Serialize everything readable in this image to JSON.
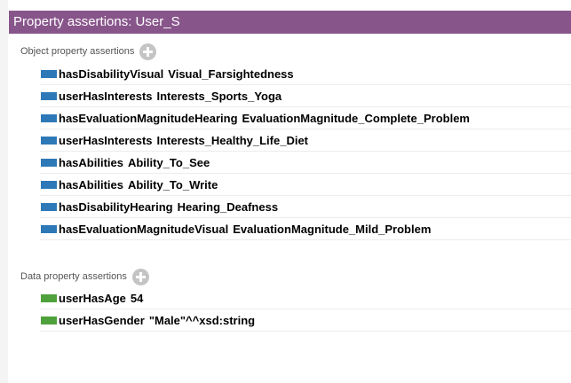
{
  "header": {
    "title": "Property assertions: User_S"
  },
  "object_section": {
    "label": "Object property assertions",
    "rows": [
      {
        "property": "hasDisabilityVisual",
        "value": "Visual_Farsightedness"
      },
      {
        "property": "userHasInterests",
        "value": "Interests_Sports_Yoga"
      },
      {
        "property": "hasEvaluationMagnitudeHearing",
        "value": "EvaluationMagnitude_Complete_Problem"
      },
      {
        "property": "userHasInterests",
        "value": "Interests_Healthy_Life_Diet"
      },
      {
        "property": "hasAbilities",
        "value": "Ability_To_See"
      },
      {
        "property": "hasAbilities",
        "value": "Ability_To_Write"
      },
      {
        "property": "hasDisabilityHearing",
        "value": "Hearing_Deafness"
      },
      {
        "property": "hasEvaluationMagnitudeVisual",
        "value": "EvaluationMagnitude_Mild_Problem"
      }
    ]
  },
  "data_section": {
    "label": "Data property assertions",
    "rows": [
      {
        "property": "userHasAge",
        "value": "54"
      },
      {
        "property": "userHasGender",
        "value": "\"Male\"^^xsd:string"
      }
    ]
  },
  "icons": {
    "object_property": "object-property-icon",
    "data_property": "data-property-icon",
    "add": "add-icon"
  },
  "colors": {
    "header_bg": "#88558b",
    "object_property": "#2d79b8",
    "data_property": "#4ea13b"
  }
}
